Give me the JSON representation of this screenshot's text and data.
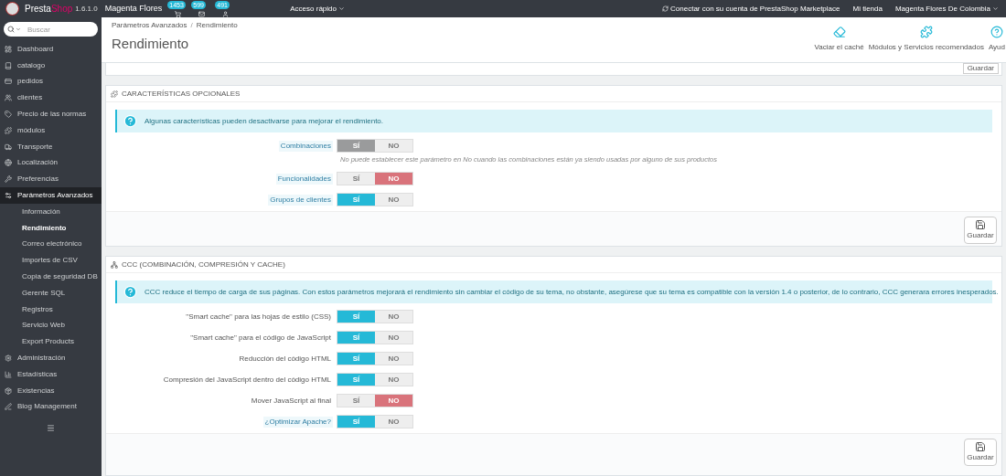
{
  "topbar": {
    "brand_a": "Presta",
    "brand_b": "Shop",
    "version": "1.6.1.0",
    "shop": "Magenta Flores",
    "badges": [
      "1453",
      "599",
      "491"
    ],
    "quick_access": "Acceso rápido",
    "marketplace": "Conectar con su cuenta de PrestaShop Marketplace",
    "my_shop": "Mi tienda",
    "user": "Magenta Flores De Colombia"
  },
  "sidebar": {
    "search_placeholder": "Buscar",
    "items": [
      {
        "label": "Dashboard",
        "kind": "dashboard",
        "selected": false
      },
      {
        "label": "catalogo",
        "kind": "book",
        "selected": false
      },
      {
        "label": "pedidos",
        "kind": "card",
        "selected": false
      },
      {
        "label": "clientes",
        "kind": "users",
        "selected": false
      },
      {
        "label": "Precio de las normas",
        "kind": "tag",
        "selected": false
      },
      {
        "label": "módulos",
        "kind": "puzzle",
        "selected": false
      },
      {
        "label": "Transporte",
        "kind": "truck",
        "selected": false
      },
      {
        "label": "Localización",
        "kind": "globe",
        "selected": false
      },
      {
        "label": "Preferencias",
        "kind": "wrench",
        "selected": false
      },
      {
        "label": "Parámetros Avanzados",
        "kind": "cogs",
        "selected": true,
        "children": [
          {
            "label": "Información",
            "selected": false
          },
          {
            "label": "Rendimiento",
            "selected": true
          },
          {
            "label": "Correo electrónico",
            "selected": false
          },
          {
            "label": "Importes de CSV",
            "selected": false
          },
          {
            "label": "Copia de seguridad DB",
            "selected": false
          },
          {
            "label": "Gerente SQL",
            "selected": false
          },
          {
            "label": "Registros",
            "selected": false
          },
          {
            "label": "Servicio Web",
            "selected": false
          },
          {
            "label": "Export Products",
            "selected": false
          }
        ]
      },
      {
        "label": "Administración",
        "kind": "cog",
        "selected": false
      },
      {
        "label": "Estadísticas",
        "kind": "chart",
        "selected": false
      },
      {
        "label": "Existencias",
        "kind": "box",
        "selected": false
      },
      {
        "label": "Blog Management",
        "kind": "pen",
        "selected": false
      }
    ]
  },
  "header": {
    "breadcrumb": [
      "Parámetros Avanzados",
      "Rendimiento"
    ],
    "breadcrumb_separator": "/",
    "title": "Rendimiento",
    "actions": [
      {
        "label": "Vaciar el caché",
        "kind": "eraser"
      },
      {
        "label": "Módulos y Servicios recomendados",
        "kind": "puzzle"
      },
      {
        "label": "Ayud",
        "kind": "help"
      }
    ]
  },
  "top_save": "Guardar",
  "panels": [
    {
      "title": "CARACTERÍSTICAS OPCIONALES",
      "kind": "features",
      "info": "Algunas características pueden desactivarse para mejorar el rendimiento.",
      "save": "Guardar",
      "rows": [
        {
          "label": "Combinaciones",
          "hint": true,
          "on": true,
          "disabled": true,
          "yes": "SÍ",
          "no": "NO",
          "help": "No puede establecer este parámetro en No cuando las combinaciones están ya siendo usadas por alguno de sus productos"
        },
        {
          "label": "Funcionalidades",
          "hint": true,
          "on": false,
          "disabled": false,
          "yes": "SÍ",
          "no": "NO"
        },
        {
          "label": "Grupos de clientes",
          "hint": true,
          "on": true,
          "disabled": false,
          "yes": "SÍ",
          "no": "NO"
        }
      ]
    },
    {
      "title": "CCC (COMBINACIÓN, COMPRESIÓN Y CACHE)",
      "kind": "ccc",
      "info": "CCC reduce el tiempo de carga de sus páginas. Con estos parámetros mejorará el rendimiento sin cambiar el código de su tema, no obstante, asegúrese que su tema es compatible con la versión 1.4 o posterior, de lo contrario, CCC generara errores inesperados.",
      "save": "Guardar",
      "rows": [
        {
          "label": "\"Smart cache\" para las hojas de estilo (CSS)",
          "hint": false,
          "on": true,
          "disabled": false,
          "yes": "SÍ",
          "no": "NO"
        },
        {
          "label": "\"Smart cache\" para el código de JavaScript",
          "hint": false,
          "on": true,
          "disabled": false,
          "yes": "SÍ",
          "no": "NO"
        },
        {
          "label": "Reducción del código HTML",
          "hint": false,
          "on": true,
          "disabled": false,
          "yes": "SÍ",
          "no": "NO"
        },
        {
          "label": "Compresión del JavaScript dentro del código HTML",
          "hint": false,
          "on": true,
          "disabled": false,
          "yes": "SÍ",
          "no": "NO"
        },
        {
          "label": "Mover JavaScript al final",
          "hint": false,
          "on": false,
          "disabled": false,
          "yes": "SÍ",
          "no": "NO"
        },
        {
          "label": "¿Optimizar Apache?",
          "hint": true,
          "on": true,
          "disabled": false,
          "yes": "SÍ",
          "no": "NO"
        }
      ]
    }
  ]
}
